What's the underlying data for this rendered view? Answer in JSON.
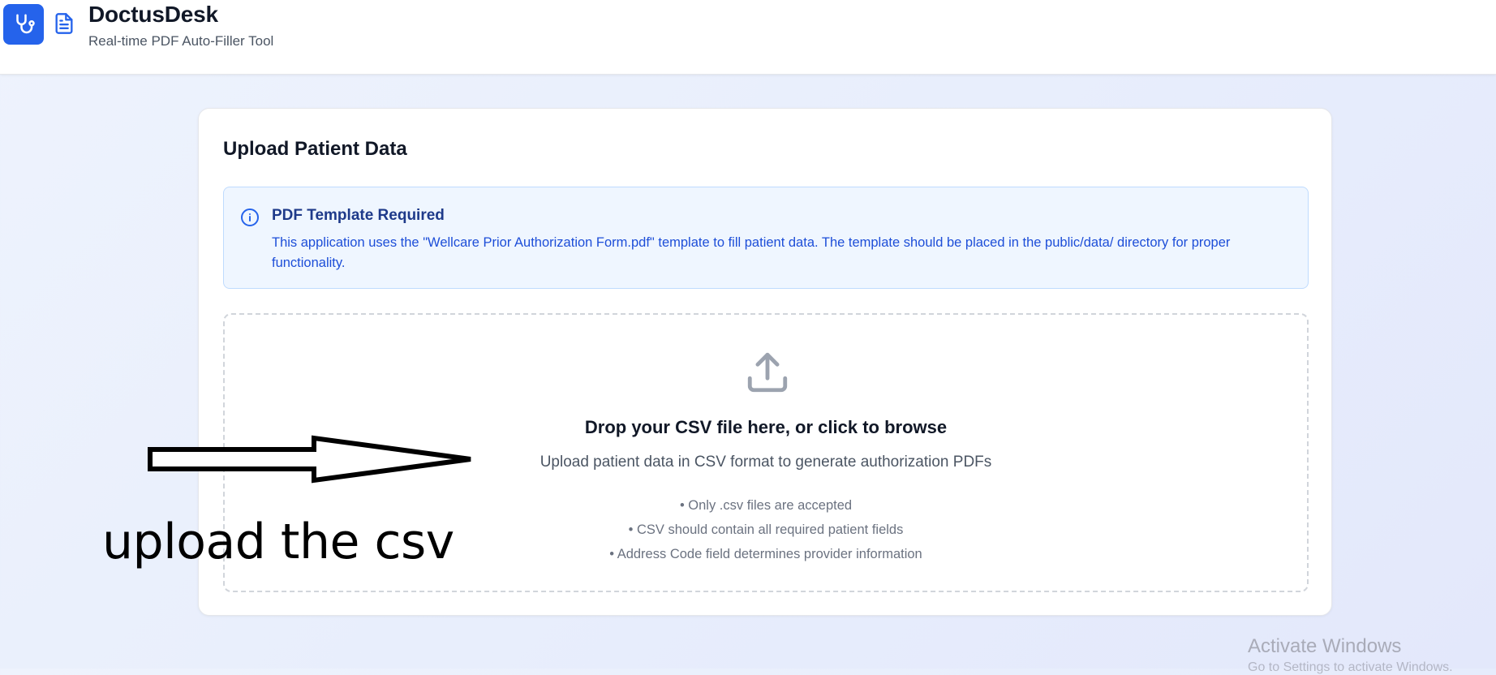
{
  "header": {
    "brand_name": "DoctusDesk",
    "tagline": "Real-time PDF Auto-Filler Tool",
    "logo_icon": "stethoscope-icon",
    "doc_icon": "file-text-icon",
    "accent_color": "#2563eb"
  },
  "card": {
    "title": "Upload Patient Data",
    "notice": {
      "icon": "info-icon",
      "title": "PDF Template Required",
      "body": "This application uses the \"Wellcare Prior Authorization Form.pdf\" template to fill patient data. The template should be placed in the public/data/ directory for proper functionality."
    },
    "dropzone": {
      "icon": "upload-icon",
      "title": "Drop your CSV file here, or click to browse",
      "subtitle": "Upload patient data in CSV format to generate authorization PDFs",
      "rules": [
        "• Only .csv files are accepted",
        "• CSV should contain all required patient fields",
        "• Address Code field determines provider information"
      ]
    }
  },
  "annotation": {
    "text": "upload the csv",
    "arrow_icon": "arrow-right-icon"
  },
  "watermark": {
    "title": "Activate Windows",
    "subtitle": "Go to Settings to activate Windows."
  }
}
